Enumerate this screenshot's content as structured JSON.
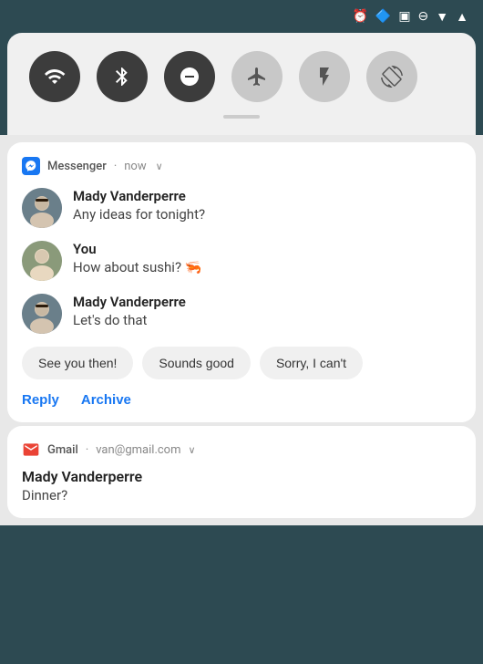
{
  "statusBar": {
    "icons": [
      "alarm",
      "bluetooth",
      "cast",
      "dnd",
      "wifi",
      "signal"
    ]
  },
  "quickSettings": {
    "buttons": [
      {
        "id": "wifi",
        "icon": "▼",
        "active": true,
        "label": "wifi"
      },
      {
        "id": "bluetooth",
        "icon": "⬡",
        "active": true,
        "label": "bluetooth"
      },
      {
        "id": "dnd",
        "icon": "−",
        "active": true,
        "label": "do-not-disturb"
      },
      {
        "id": "airplane",
        "icon": "✈",
        "active": false,
        "label": "airplane-mode"
      },
      {
        "id": "flashlight",
        "icon": "🔦",
        "active": false,
        "label": "flashlight"
      },
      {
        "id": "rotate",
        "icon": "⟳",
        "active": false,
        "label": "rotate"
      }
    ]
  },
  "messengerNotif": {
    "appName": "Messenger",
    "time": "now",
    "expandIcon": "∨",
    "messages": [
      {
        "sender": "Mady Vanderperre",
        "text": "Any ideas for tonight?",
        "avatar": "mady"
      },
      {
        "sender": "You",
        "text": "How about sushi? 🦐",
        "avatar": "you"
      },
      {
        "sender": "Mady Vanderperre",
        "text": "Let's do that",
        "avatar": "mady"
      }
    ],
    "smartReplies": [
      "See you then!",
      "Sounds good",
      "Sorry, I can't"
    ],
    "actions": [
      {
        "id": "reply",
        "label": "Reply"
      },
      {
        "id": "archive",
        "label": "Archive"
      }
    ]
  },
  "gmailNotif": {
    "appName": "Gmail",
    "account": "van@gmail.com",
    "expandIcon": "∨",
    "sender": "Mady Vanderperre",
    "subject": "Dinner?"
  }
}
